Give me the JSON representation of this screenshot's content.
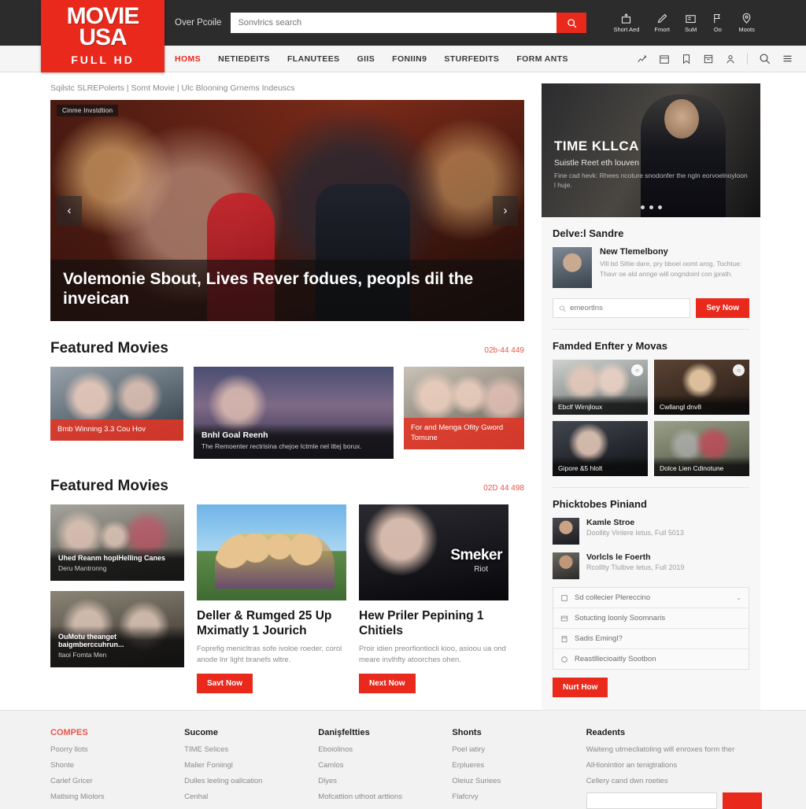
{
  "header": {
    "logo_main": "MOVIE\nUSA",
    "logo_line1": "MOVIE",
    "logo_line2": "USA",
    "logo_sub": "FULL HD",
    "top_label": "Over Pcoile",
    "search_placeholder": "Sonvlrics search",
    "search_icon": "search-icon",
    "icons": [
      {
        "icon": "upload-box-icon",
        "label": "Short Aed"
      },
      {
        "icon": "pencil-icon",
        "label": "Fmort"
      },
      {
        "icon": "news-icon",
        "label": "SuM"
      },
      {
        "icon": "flag-icon",
        "label": "Oo"
      },
      {
        "icon": "location-pin-icon",
        "label": "Moots"
      }
    ]
  },
  "nav": {
    "items": [
      {
        "label": "HOMS",
        "active": true
      },
      {
        "label": "NETIEDEITS",
        "active": false
      },
      {
        "label": "FLANUTEES",
        "active": false
      },
      {
        "label": "GIIS",
        "active": false
      },
      {
        "label": "FONIIN9",
        "active": false
      },
      {
        "label": "STURFEDITS",
        "active": false
      },
      {
        "label": "FORM ANTS",
        "active": false
      }
    ],
    "right_icons": [
      "chart-icon",
      "calendar-icon",
      "bookmark-icon",
      "calendar-day-icon",
      "user-icon"
    ],
    "search_icon": "search-icon",
    "menu_icon": "hamburger-menu-icon"
  },
  "breadcrumb": "Sqilstc SLREPolerts | Somt Movie | Ulc Blooning Grnems Indeuscs",
  "hero": {
    "badge": "Cinme Invstdtion",
    "title": "Volemonie Sbout, Lives Rever fodues, peopls dil the inveican",
    "prev_label": "‹",
    "next_label": "›"
  },
  "sections": [
    {
      "title": "Featured Movies",
      "link": "02b-44 449",
      "cards": [
        {
          "caption": "Bmb Winning 3.3 Cou Hov",
          "style": "red"
        },
        {
          "caption": "Bnhl Goal Reenh",
          "desc": "The Remoenter rectrisina chejoe Ictmle nel ittej borux.",
          "style": "dark"
        },
        {
          "caption": "For and Menga Ofity Gword Tomune",
          "style": "red"
        }
      ]
    },
    {
      "title": "Featured Movies",
      "link": "02D 44 498"
    }
  ],
  "row2": {
    "mini_cards": [
      {
        "title": "Uhed Reanm hoplHelling Canes",
        "sub": "Deru Mantronng"
      },
      {
        "title": "OuMotu theanget baigmberccuhrun...",
        "sub": "Itaoi Fomta Men"
      }
    ],
    "articles": [
      {
        "title": "Deller & Rumged 25 Up Mximatly 1 Jourich",
        "desc": "Foprefig menicltras sofe ivoloe roeder, corol anode lnr light branefs wltre.",
        "button": "Savt Now",
        "poster_word": "",
        "poster_sub": ""
      },
      {
        "title": "Hew Priler Pepining 1 Chitiels",
        "desc": "Proir idien preorfiontiocli kioo, asioou ua ond meare invlhfty atoorches ohen.",
        "button": "Next Now",
        "poster_word": "Smeker",
        "poster_sub": "Riot"
      }
    ]
  },
  "sidebar": {
    "hero": {
      "title": "TIME KLLCA",
      "subtitle": "Suistle Reet eth louven",
      "desc": "Fine cad hevk: Rhees ncoture snodonfer the ngln eorvoelnoyloon l huje.",
      "dots": 3
    },
    "news": {
      "heading": "Delve:l Sandre",
      "post_title": "New Tlemelbony",
      "post_desc": "Vlll bd Slltie dare, pry bboel oomt arog, Tochtue: Thavr oe ald annge will ongndoinl con jprath.",
      "input_placeholder": "emeortlns",
      "search_icon": "search-icon",
      "button": "Sey Now"
    },
    "grid": {
      "heading": "Famded Enfter y Movas",
      "badge_icon": "circle-icon",
      "cells": [
        {
          "caption": "Ebclf Wirnjloux",
          "badge": "○"
        },
        {
          "caption": "Cwllangl dnv8",
          "badge": "○"
        },
        {
          "caption": "Gipore &5 hlolt",
          "badge": ""
        },
        {
          "caption": "Dolce Lien Cdinotune",
          "badge": ""
        }
      ]
    },
    "people": {
      "heading": "Phicktobes Piniand",
      "items": [
        {
          "name": "Kamle Stroe",
          "meta": "Doollity Vinlere Ietus, Full 5013"
        },
        {
          "name": "Vorlcls le Foerth",
          "meta": "Rcolllty Tlulbve Ietus, Full 2019"
        }
      ]
    },
    "options": {
      "items": [
        {
          "icon": "square-icon",
          "label": "Sd collecier Plereccino",
          "chevron": "⌄"
        },
        {
          "icon": "card-icon",
          "label": "Sotucting loonly Soomnaris",
          "chevron": ""
        },
        {
          "icon": "calendar-icon",
          "label": "Sadis Emingl?",
          "chevron": ""
        },
        {
          "icon": "circle-icon",
          "label": "Reastlllecioaitly Sootbon",
          "chevron": ""
        }
      ],
      "button": "Nurt How"
    }
  },
  "footer": {
    "columns": [
      {
        "heading": "COMPES",
        "heading_red": true,
        "links": [
          "Poorry llots",
          "Shonte",
          "Carlef Gricer",
          "Matlsing Miolors"
        ]
      },
      {
        "heading": "Sucome",
        "heading_red": false,
        "links": [
          "TIME Selices",
          "Malier Foniingl",
          "Dulles leeling oallcation",
          "Cenhal"
        ]
      },
      {
        "heading": "Danişfeltties",
        "heading_red": false,
        "links": [
          "Eboiolinos",
          "Camlos",
          "Dlyes",
          "Mofcattion uthoot arttions"
        ]
      },
      {
        "heading": "Shonts",
        "heading_red": false,
        "links": [
          "Poel iatiry",
          "Erplueres",
          "Oleiuz Suriees",
          "Flafcrvy"
        ]
      }
    ],
    "subscribe": {
      "heading": "Readents",
      "lines": [
        "Waiteng utrnecliatoling will enroxes form ther",
        "AlHlonintior an tenigtralions",
        "Cellery cand dwn roeties"
      ],
      "input_placeholder": "",
      "button": ""
    }
  }
}
